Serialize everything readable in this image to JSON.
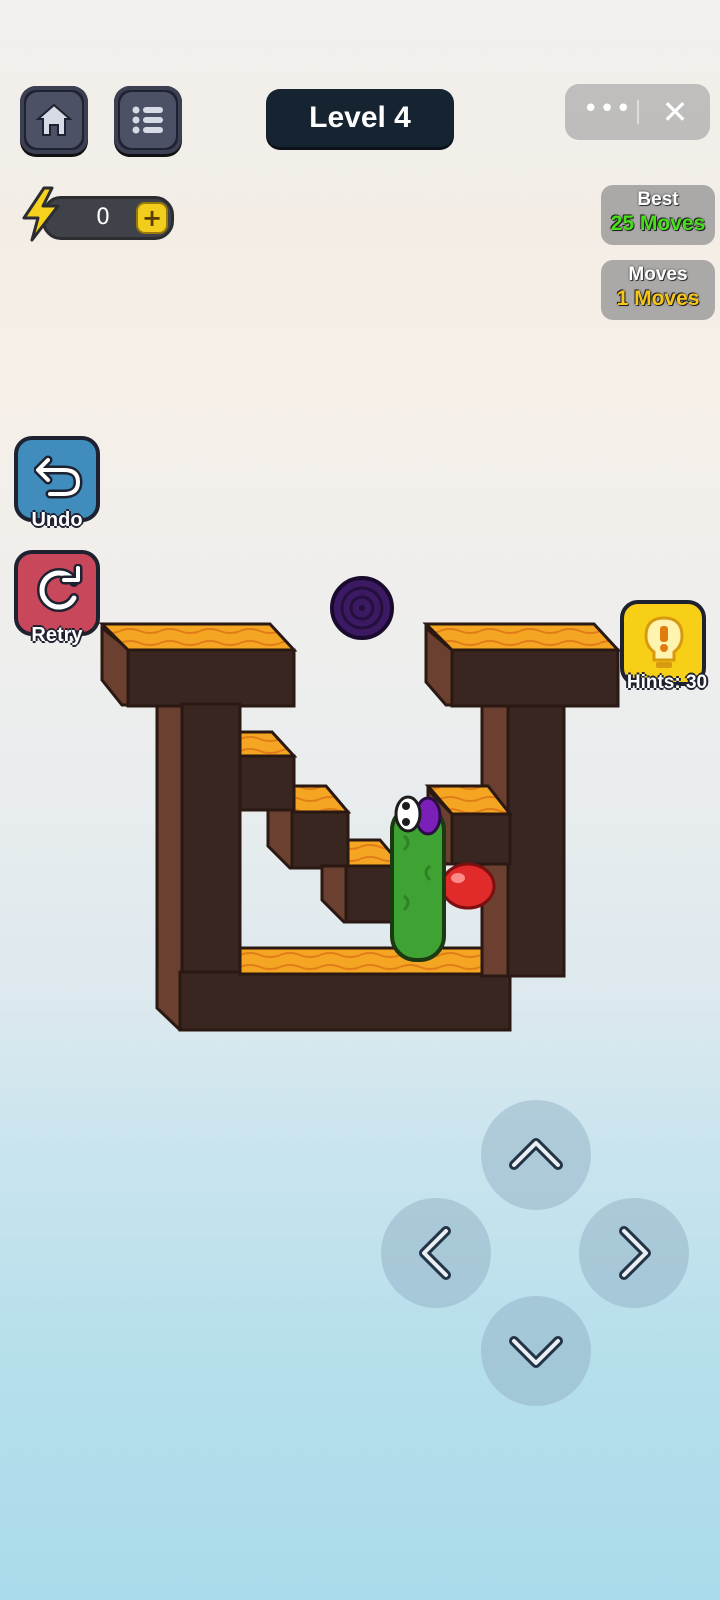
{
  "header": {
    "home_icon": "home-icon",
    "menu_icon": "list-icon",
    "level_label": "Level 4",
    "more_icon": "more-dots-icon",
    "more_glyph": "•••",
    "close_icon": "close-icon",
    "close_glyph": "✕"
  },
  "energy": {
    "icon": "lightning-icon",
    "value": "0",
    "add_glyph": "+"
  },
  "stats": {
    "best_label": "Best",
    "best_value": "25 Moves",
    "moves_label": "Moves",
    "moves_value": "1 Moves",
    "best_color": "#47e01a",
    "moves_color": "#f7c619"
  },
  "side": {
    "undo_label": "Undo",
    "retry_label": "Retry",
    "hint_label": "Hints: 30",
    "undo_color": "#3f8cbd",
    "retry_color": "#c9475a",
    "hint_color": "#f7cf16"
  },
  "controls": {
    "up": "arrow-up-icon",
    "left": "arrow-left-icon",
    "right": "arrow-right-icon",
    "down": "arrow-down-icon"
  },
  "board": {
    "grass_color": "#f4a622",
    "soil_color": "#3a2620",
    "side_color": "#6b4030",
    "worm_color": "#3ea332",
    "apple_color": "#e12a2a",
    "portal_color": "#3b1a63"
  }
}
